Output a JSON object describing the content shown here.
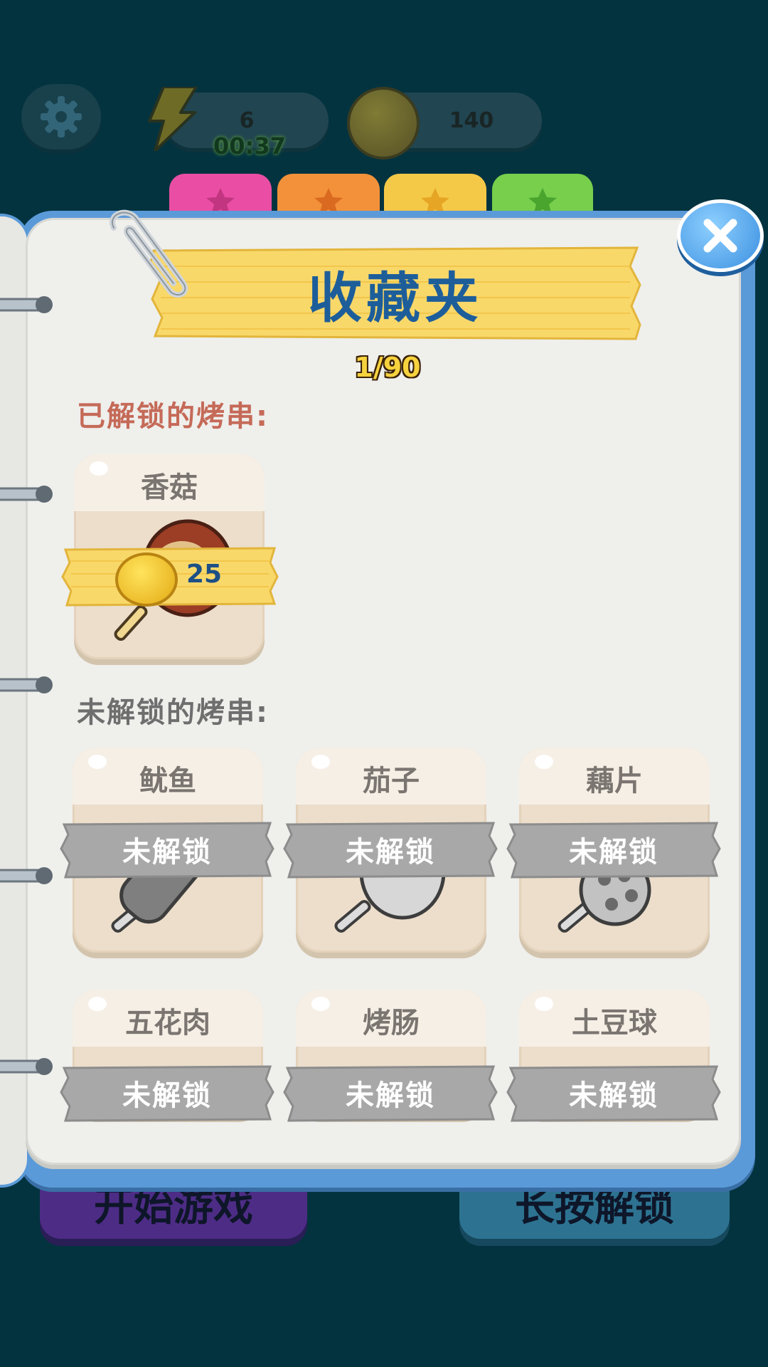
{
  "hud": {
    "energy": "6",
    "timer": "00:37",
    "coins": "140",
    "settings_icon": "gear-icon"
  },
  "tabs": [
    {
      "color": "#ea4ea4",
      "icon": "star-icon"
    },
    {
      "color": "#f3913a",
      "icon": "star-icon"
    },
    {
      "color": "#f4c947",
      "icon": "star-icon"
    },
    {
      "color": "#77cf4c",
      "icon": "star-icon"
    }
  ],
  "collection": {
    "title": "收藏夹",
    "counter": "1/90",
    "unlocked_heading": "已解锁的烤串:",
    "locked_heading": "未解锁的烤串:",
    "unlocked_items": [
      {
        "name": "香菇",
        "price": "25",
        "food_icon": "mushroom-skewer-icon"
      }
    ],
    "locked_items": [
      {
        "name": "鱿鱼",
        "status": "未解锁",
        "food_icon": "squid-skewer-icon"
      },
      {
        "name": "茄子",
        "status": "未解锁",
        "food_icon": "eggplant-skewer-icon"
      },
      {
        "name": "藕片",
        "status": "未解锁",
        "food_icon": "lotus-root-skewer-icon"
      },
      {
        "name": "五花肉",
        "status": "未解锁",
        "food_icon": "pork-belly-skewer-icon"
      },
      {
        "name": "烤肠",
        "status": "未解锁",
        "food_icon": "sausage-skewer-icon"
      },
      {
        "name": "土豆球",
        "status": "未解锁",
        "food_icon": "potato-ball-skewer-icon"
      }
    ]
  },
  "background_buttons": {
    "start": "开始游戏",
    "long_press_unlock": "长按解锁"
  },
  "colors": {
    "background": "#03333f",
    "notebook_border": "#5b9ad8",
    "title_text": "#1d5e9a",
    "price_text": "#1d4f86"
  }
}
